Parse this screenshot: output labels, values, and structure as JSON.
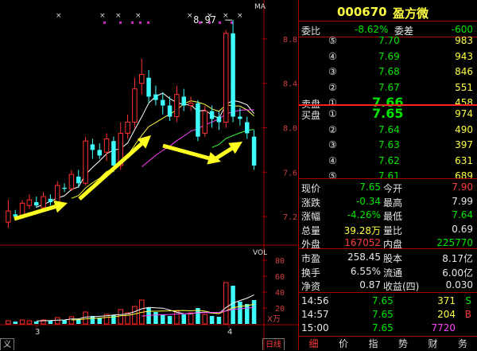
{
  "chart": {
    "ma_label": "MA",
    "vol_label": "VOL",
    "peak_label": "8.97",
    "price_ticks": [
      "8.8",
      "8.4",
      "8.0",
      "7.6",
      "7.2"
    ],
    "vol_ticks": [
      "80",
      "60",
      "40",
      "20"
    ],
    "vol_unit": "X万",
    "date_ticks": [
      "3",
      "4"
    ],
    "markers": "×"
  },
  "chart_data": {
    "type": "candlestick",
    "ylim": [
      7.0,
      9.05
    ],
    "candles": [
      {
        "o": 7.15,
        "c": 7.25,
        "h": 7.35,
        "l": 7.1,
        "up": true
      },
      {
        "o": 7.22,
        "c": 7.2,
        "h": 7.26,
        "l": 7.18,
        "up": false
      },
      {
        "o": 7.2,
        "c": 7.32,
        "h": 7.35,
        "l": 7.18,
        "up": true
      },
      {
        "o": 7.3,
        "c": 7.35,
        "h": 7.4,
        "l": 7.27,
        "up": true
      },
      {
        "o": 7.33,
        "c": 7.3,
        "h": 7.38,
        "l": 7.28,
        "up": false
      },
      {
        "o": 7.28,
        "c": 7.38,
        "h": 7.42,
        "l": 7.26,
        "up": true
      },
      {
        "o": 7.36,
        "c": 7.33,
        "h": 7.4,
        "l": 7.3,
        "up": false
      },
      {
        "o": 7.32,
        "c": 7.48,
        "h": 7.52,
        "l": 7.3,
        "up": true
      },
      {
        "o": 7.46,
        "c": 7.45,
        "h": 7.5,
        "l": 7.42,
        "up": false
      },
      {
        "o": 7.45,
        "c": 7.58,
        "h": 7.62,
        "l": 7.43,
        "up": true
      },
      {
        "o": 7.56,
        "c": 7.5,
        "h": 7.62,
        "l": 7.46,
        "up": false
      },
      {
        "o": 7.5,
        "c": 7.88,
        "h": 7.92,
        "l": 7.48,
        "up": true
      },
      {
        "o": 7.85,
        "c": 7.8,
        "h": 7.9,
        "l": 7.72,
        "up": false
      },
      {
        "o": 7.8,
        "c": 7.75,
        "h": 7.86,
        "l": 7.72,
        "up": false
      },
      {
        "o": 7.78,
        "c": 7.9,
        "h": 7.95,
        "l": 7.7,
        "up": true
      },
      {
        "o": 7.88,
        "c": 7.66,
        "h": 7.92,
        "l": 7.6,
        "up": false
      },
      {
        "o": 7.66,
        "c": 7.95,
        "h": 8.05,
        "l": 7.62,
        "up": true
      },
      {
        "o": 7.95,
        "c": 8.05,
        "h": 8.12,
        "l": 7.9,
        "up": true
      },
      {
        "o": 8.05,
        "c": 8.35,
        "h": 8.45,
        "l": 8.0,
        "up": true
      },
      {
        "o": 8.4,
        "c": 8.48,
        "h": 8.62,
        "l": 8.3,
        "up": true
      },
      {
        "o": 8.45,
        "c": 8.28,
        "h": 8.52,
        "l": 8.22,
        "up": false
      },
      {
        "o": 8.3,
        "c": 8.25,
        "h": 8.38,
        "l": 8.2,
        "up": false
      },
      {
        "o": 8.25,
        "c": 8.2,
        "h": 8.32,
        "l": 8.12,
        "up": false
      },
      {
        "o": 8.2,
        "c": 8.1,
        "h": 8.28,
        "l": 8.06,
        "up": false
      },
      {
        "o": 8.1,
        "c": 8.3,
        "h": 8.38,
        "l": 8.05,
        "up": true
      },
      {
        "o": 8.28,
        "c": 8.2,
        "h": 8.35,
        "l": 8.15,
        "up": false
      },
      {
        "o": 8.2,
        "c": 8.22,
        "h": 8.28,
        "l": 8.15,
        "up": true
      },
      {
        "o": 8.22,
        "c": 7.92,
        "h": 8.25,
        "l": 7.88,
        "up": false
      },
      {
        "o": 7.95,
        "c": 8.15,
        "h": 8.2,
        "l": 7.92,
        "up": true
      },
      {
        "o": 8.15,
        "c": 8.08,
        "h": 8.2,
        "l": 8.0,
        "up": false
      },
      {
        "o": 8.1,
        "c": 8.05,
        "h": 8.15,
        "l": 7.98,
        "up": false
      },
      {
        "o": 8.05,
        "c": 8.85,
        "h": 8.88,
        "l": 8.0,
        "up": true
      },
      {
        "o": 8.85,
        "c": 8.1,
        "h": 8.97,
        "l": 8.05,
        "up": false
      },
      {
        "o": 8.1,
        "c": 8.08,
        "h": 8.18,
        "l": 8.02,
        "up": false
      },
      {
        "o": 8.05,
        "c": 7.95,
        "h": 8.1,
        "l": 7.9,
        "up": false
      },
      {
        "o": 7.92,
        "c": 7.66,
        "h": 7.98,
        "l": 7.62,
        "up": false
      }
    ],
    "volumes": [
      4,
      3,
      5,
      4,
      3,
      5,
      4,
      8,
      5,
      9,
      6,
      15,
      10,
      8,
      12,
      11,
      18,
      14,
      22,
      30,
      20,
      15,
      12,
      10,
      16,
      12,
      14,
      20,
      12,
      10,
      9,
      52,
      48,
      28,
      25,
      30
    ]
  },
  "quote": {
    "code": "000670",
    "name": "盈方微",
    "weibi_label": "委比",
    "weibi_value": "-8.62%",
    "weicha_label": "委差",
    "weicha_value": "-600",
    "sell_label": "卖盘",
    "buy_label": "买盘",
    "sell": [
      {
        "lvl": "⑤",
        "price": "7.70",
        "vol": "983"
      },
      {
        "lvl": "④",
        "price": "7.69",
        "vol": "943"
      },
      {
        "lvl": "③",
        "price": "7.68",
        "vol": "846"
      },
      {
        "lvl": "②",
        "price": "7.67",
        "vol": "551"
      },
      {
        "lvl": "①",
        "price": "7.66",
        "vol": "458"
      }
    ],
    "buy": [
      {
        "lvl": "①",
        "price": "7.65",
        "vol": "974"
      },
      {
        "lvl": "②",
        "price": "7.64",
        "vol": "490"
      },
      {
        "lvl": "③",
        "price": "7.63",
        "vol": "397"
      },
      {
        "lvl": "④",
        "price": "7.62",
        "vol": "631"
      },
      {
        "lvl": "⑤",
        "price": "7.61",
        "vol": "689"
      }
    ],
    "stats": [
      {
        "l1": "现价",
        "v1": "7.65",
        "c1": "green",
        "l2": "今开",
        "v2": "7.90",
        "c2": "red"
      },
      {
        "l1": "涨跌",
        "v1": "-0.34",
        "c1": "green",
        "l2": "最高",
        "v2": "7.99",
        "c2": "white"
      },
      {
        "l1": "涨幅",
        "v1": "-4.26%",
        "c1": "green",
        "l2": "最低",
        "v2": "7.64",
        "c2": "green"
      },
      {
        "l1": "总量",
        "v1": "39.28万",
        "c1": "yellow",
        "l2": "量比",
        "v2": "0.69",
        "c2": "white"
      },
      {
        "l1": "外盘",
        "v1": "167052",
        "c1": "red",
        "l2": "内盘",
        "v2": "225770",
        "c2": "green"
      }
    ],
    "fin": [
      {
        "l1": "市盈",
        "v1": "258.45",
        "l2": "股本",
        "v2": "8.17亿"
      },
      {
        "l1": "换手",
        "v1": "6.55%",
        "l2": "流通",
        "v2": "6.00亿"
      },
      {
        "l1": "净资",
        "v1": "0.87",
        "l2": "收益(四)",
        "v2": "0.030"
      }
    ],
    "ticks": [
      {
        "time": "14:56",
        "price": "7.65",
        "vol": "371",
        "flag": "S",
        "fc": "green"
      },
      {
        "time": "14:57",
        "price": "7.65",
        "vol": "204",
        "flag": "B",
        "fc": "red"
      },
      {
        "time": "15:00",
        "price": "7.65",
        "vol": "7720",
        "flag": "",
        "fc": "magenta"
      }
    ],
    "tabs": [
      "细",
      "价",
      "指",
      "势",
      "财",
      "务"
    ]
  },
  "left_tabs": [
    "义",
    "日线"
  ]
}
